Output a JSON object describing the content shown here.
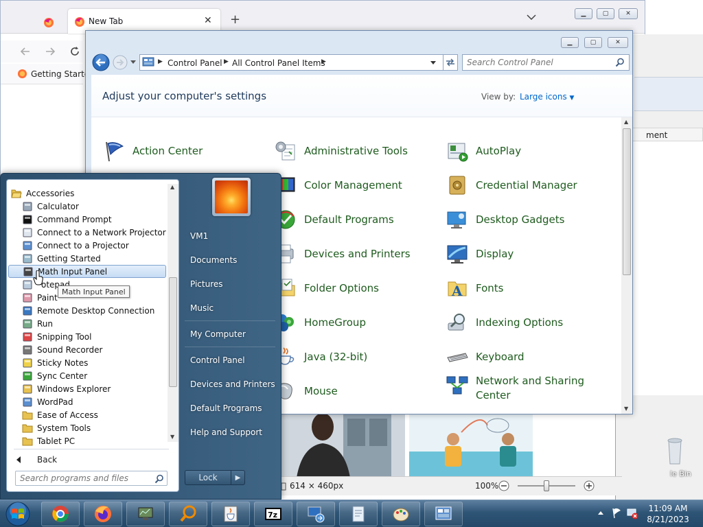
{
  "firefox": {
    "tab_title": "New Tab",
    "bookmark": "Getting Started"
  },
  "control_panel": {
    "breadcrumb": [
      "Control Panel",
      "All Control Panel Items"
    ],
    "search_placeholder": "Search Control Panel",
    "heading": "Adjust your computer's settings",
    "view_by_label": "View by:",
    "view_by_value": "Large icons",
    "items": [
      [
        "Action Center",
        "Administrative Tools",
        "AutoPlay"
      ],
      [
        "Color Management",
        "Credential Manager"
      ],
      [
        "Default Programs",
        "Desktop Gadgets"
      ],
      [
        "Devices and Printers",
        "Display"
      ],
      [
        "Folder Options",
        "Fonts"
      ],
      [
        "HomeGroup",
        "Indexing Options"
      ],
      [
        "Java (32-bit)",
        "Keyboard"
      ],
      [
        "Mouse",
        "Network and Sharing Center"
      ]
    ]
  },
  "start_menu": {
    "folder": "Accessories",
    "programs": [
      "Calculator",
      "Command Prompt",
      "Connect to a Network Projector",
      "Connect to a Projector",
      "Getting Started",
      "Math Input Panel",
      "Notepad",
      "Paint",
      "Remote Desktop Connection",
      "Run",
      "Snipping Tool",
      "Sound Recorder",
      "Sticky Notes",
      "Sync Center",
      "Windows Explorer",
      "WordPad"
    ],
    "notepad_visible": "otepad",
    "subfolders": [
      "Ease of Access",
      "System Tools",
      "Tablet PC"
    ],
    "back": "Back",
    "search_placeholder": "Search programs and files",
    "right_items": [
      "VM1",
      "Documents",
      "Pictures",
      "Music",
      "My Computer",
      "Control Panel",
      "Devices and Printers",
      "Default Programs",
      "Help and Support"
    ],
    "shutdown_label": "Lock",
    "tooltip": "Math Input Panel"
  },
  "photo_viewer": {
    "dimensions": "614 × 460px",
    "zoom": "100%"
  },
  "desktop": {
    "recycle_bin_partial": "le Bin",
    "list_column_partial": "ment"
  },
  "taskbar": {
    "time": "11:09 AM",
    "date": "8/21/2023",
    "apps": [
      "chrome-icon",
      "firefox-icon",
      "network-monitor-icon",
      "search-magnifier-icon",
      "java-icon",
      "7zip-icon",
      "remote-desktop-icon",
      "notepad-doc-icon",
      "paint-icon",
      "control-panel-icon"
    ]
  },
  "colors": {
    "link_green": "#1e5b1e",
    "heading_blue": "#1e395b",
    "taskbar": "#2f5576",
    "start_menu": "#3f6585"
  }
}
